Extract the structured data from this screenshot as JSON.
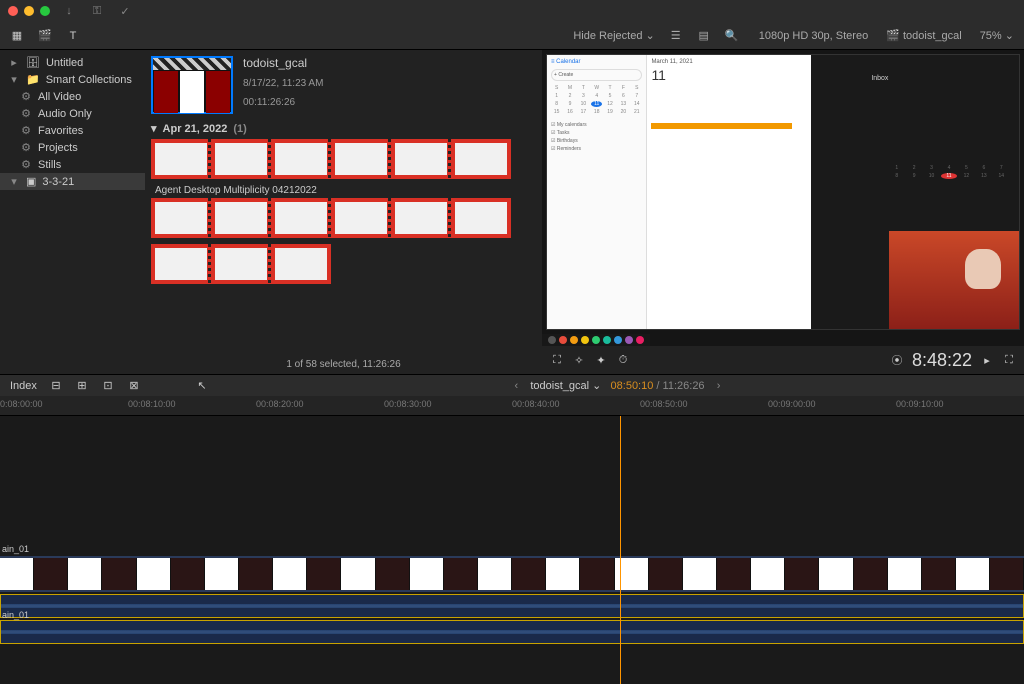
{
  "titlebar": {
    "icons": [
      "download",
      "key",
      "check"
    ]
  },
  "toolbar": {
    "hide_rejected": "Hide Rejected",
    "format": "1080p HD 30p, Stereo",
    "project": "todoist_gcal",
    "zoom": "75%"
  },
  "sidebar": {
    "untitled": "Untitled",
    "smart": "Smart Collections",
    "items": [
      "All Video",
      "Audio Only",
      "Favorites",
      "Projects",
      "Stills"
    ],
    "event": "3-3-21"
  },
  "browser": {
    "clip_title": "todoist_gcal",
    "clip_date": "8/17/22, 11:23 AM",
    "clip_dur": "00:11:26:26",
    "date_header": "Apr 21, 2022",
    "date_count": "(1)",
    "clip2_title": "Agent Desktop Multiplicity 04212022",
    "status": "1 of 58 selected, 11:26:26"
  },
  "viewer": {
    "cal_title": "Calendar",
    "cal_date": "March 11, 2021",
    "day_big": "11",
    "timecode": "8:48:22",
    "inbox": "Inbox",
    "create": "Create"
  },
  "timeline": {
    "index": "Index",
    "project": "todoist_gcal",
    "current": "08:50:10",
    "duration": "11:26:26",
    "ruler": [
      "0:08:00:00",
      "00:08:10:00",
      "00:08:20:00",
      "00:08:30:00",
      "00:08:40:00",
      "00:08:50:00",
      "00:09:00:00",
      "00:09:10:00"
    ],
    "track_v": "ain_01",
    "track_a": "ain_01"
  }
}
